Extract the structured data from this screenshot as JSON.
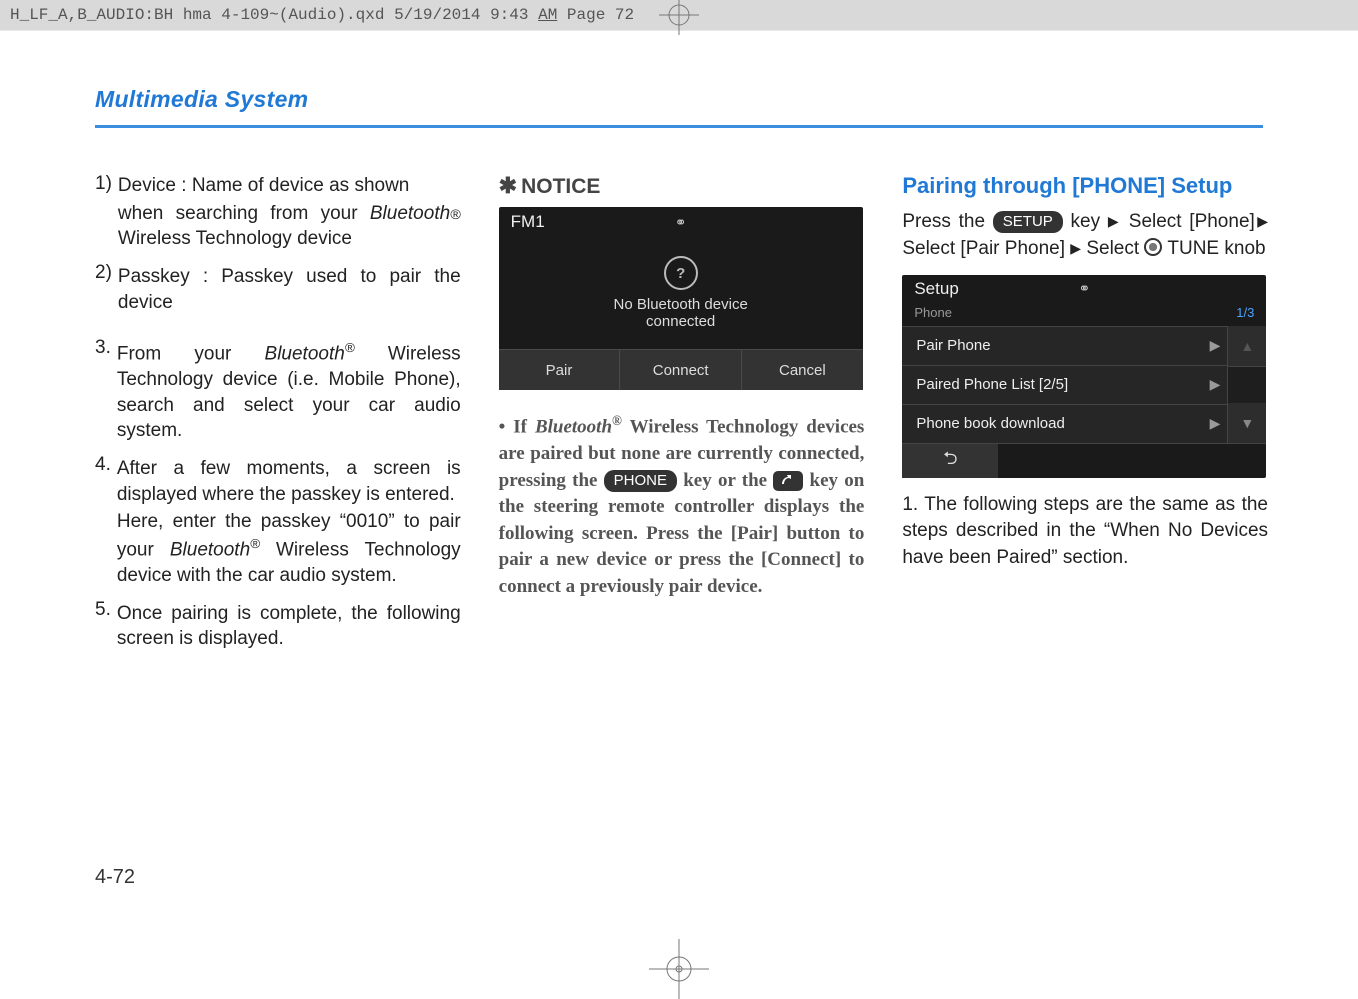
{
  "topstrip": {
    "text_prefix": "H_LF_A,B_AUDIO:BH hma 4-109~(Audio).qxd  5/19/2014  9:43 ",
    "text_am": "AM",
    "text_after_am": "  P",
    "text_suffix": "age 72"
  },
  "section_title": "Multimedia System",
  "page_number": "4-72",
  "left": {
    "sub1_num": "1)",
    "sub1_lead": "Device : Name of device as shown",
    "sub1_body_a": "when searching from your ",
    "sub1_bt": "Bluetooth",
    "sub1_reg": "®",
    "sub1_body_b": " Wireless Technology device",
    "sub2_num": "2)",
    "sub2_text": "Passkey : Passkey used to pair the device",
    "n3_num": "3.",
    "n3_a": "From your ",
    "n3_bt": "Bluetooth",
    "n3_reg": "®",
    "n3_b": " Wireless Technology device (i.e. Mobile Phone), search and select your car audio system.",
    "n4_num": "4.",
    "n4_a": "After a few moments, a screen is displayed where the passkey is entered.",
    "n4_b_a": "Here, enter the passkey “0010” to pair your ",
    "n4_bt": "Bluetooth",
    "n4_reg": "®",
    "n4_b_b": "  Wireless Technology device with the car audio system.",
    "n5_num": "5.",
    "n5_text": "Once pairing is complete, the following screen is displayed."
  },
  "mid": {
    "notice_head": "NOTICE",
    "ss1": {
      "fm": "FM1",
      "nobtl1": "No Bluetooth device",
      "nobtl2": "connected",
      "pair": "Pair",
      "connect": "Connect",
      "cancel": "Cancel"
    },
    "body_bullet": "•",
    "body_if": "If ",
    "body_bt": "Bluetooth",
    "body_reg": "®",
    "body_1": "  Wireless Technology devices are paired but none are currently connected, pressing the ",
    "pill_phone": "PHONE",
    "body_2": " key or the ",
    "body_3": " key on the steering remote controller displays the following screen. Press the [Pair] button to pair a new device or press the [Connect] to connect a previously pair device."
  },
  "right": {
    "heading": "Pairing through [PHONE] Setup",
    "lead_a": "Press the ",
    "pill_setup": "SETUP",
    "lead_b": " key ",
    "lead_c": "Select [Phone]",
    "lead_d": "Select [Pair Phone] ",
    "lead_e": " Select ",
    "lead_f": "TUNE knob",
    "ss2": {
      "setup": "Setup",
      "sub_phone": "Phone",
      "sub_count": "1/3",
      "row1": "Pair Phone",
      "row2": "Paired Phone List  [2/5]",
      "row3": "Phone book download"
    },
    "step1_num": "1.",
    "step1_text": "The following steps are the same as the steps described in the “When No Devices have been Paired” section."
  }
}
